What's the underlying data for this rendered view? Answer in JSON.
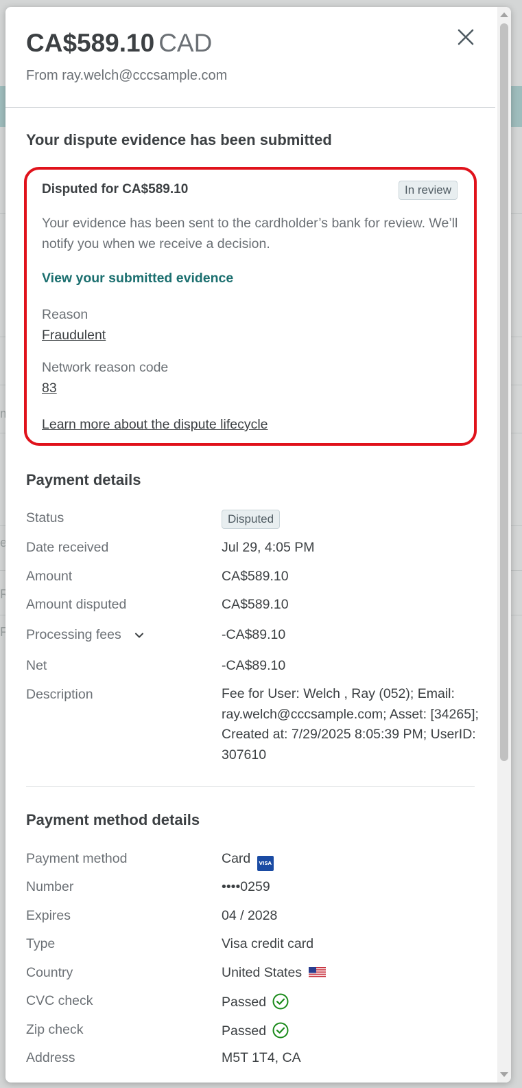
{
  "header": {
    "amount": "CA$589.10",
    "currency": "CAD",
    "from_text": "From ray.welch@cccsample.com"
  },
  "dispute": {
    "section_title": "Your dispute evidence has been submitted",
    "title": "Disputed for CA$589.10",
    "status_badge": "In review",
    "description": "Your evidence has been sent to the cardholder’s bank for review. We’ll notify you when we receive a decision.",
    "view_link": "View your submitted evidence",
    "reason_label": "Reason",
    "reason_value": "Fraudulent",
    "code_label": "Network reason code",
    "code_value": "83",
    "learn_more_link": "Learn more about the dispute lifecycle",
    "highlight_color": "#e0121b"
  },
  "payment_details": {
    "title": "Payment details",
    "status_label": "Status",
    "status_badge": "Disputed",
    "date_label": "Date received",
    "date_value": "Jul 29, 4:05 PM",
    "amount_label": "Amount",
    "amount_value": "CA$589.10",
    "amount_disputed_label": "Amount disputed",
    "amount_disputed_value": "CA$589.10",
    "fees_label": "Processing fees",
    "fees_value": "-CA$89.10",
    "net_label": "Net",
    "net_value": "-CA$89.10",
    "description_label": "Description",
    "description_value": "Fee for User: Welch , Ray (052); Email: ray.welch@cccsample.com; Asset: [34265]; Created at: 7/29/2025 8:05:39 PM; UserID: 307610"
  },
  "payment_method": {
    "title": "Payment method details",
    "method_label": "Payment method",
    "method_value": "Card",
    "card_brand_icon": "visa-icon",
    "card_brand_text": "VISA",
    "number_label": "Number",
    "number_value": "••••0259",
    "expires_label": "Expires",
    "expires_value": "04 / 2028",
    "type_label": "Type",
    "type_value": "Visa credit card",
    "country_label": "Country",
    "country_value": "United States",
    "country_icon": "us-flag-icon",
    "cvc_label": "CVC check",
    "cvc_value": "Passed",
    "zip_label": "Zip check",
    "zip_value": "Passed",
    "check_icon": "check-circle-icon",
    "check_color": "#1a8a1a",
    "address_label": "Address",
    "address_value": "M5T 1T4, CA"
  },
  "background": {
    "edge_chars": [
      "m",
      "e",
      "R",
      "F"
    ]
  }
}
